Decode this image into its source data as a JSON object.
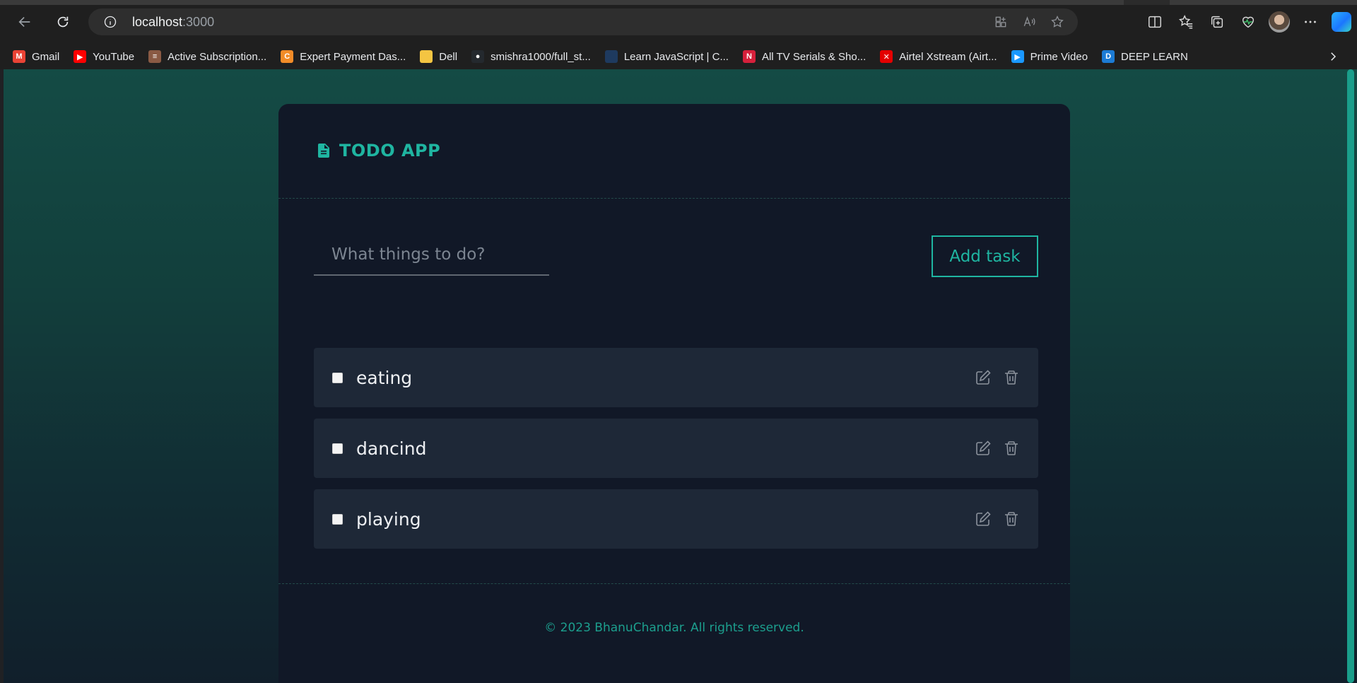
{
  "browser": {
    "url_host": "localhost",
    "url_port": ":3000",
    "bookmarks": [
      {
        "label": "Gmail",
        "color": "#ea4335",
        "glyph": "M"
      },
      {
        "label": "YouTube",
        "color": "#ff0000",
        "glyph": "▶"
      },
      {
        "label": "Active Subscription...",
        "color": "#8a5a44",
        "glyph": "≡"
      },
      {
        "label": "Expert Payment Das...",
        "color": "#f28c28",
        "glyph": "C"
      },
      {
        "label": "Dell",
        "color": "#f4c542",
        "glyph": ""
      },
      {
        "label": "smishra1000/full_st...",
        "color": "#24292e",
        "glyph": "●"
      },
      {
        "label": "Learn JavaScript | C...",
        "color": "#1e3a5f",
        "glyph": ""
      },
      {
        "label": "All TV Serials & Sho...",
        "color": "#d6203b",
        "glyph": "N"
      },
      {
        "label": "Airtel Xstream (Airt...",
        "color": "#e40000",
        "glyph": "✕"
      },
      {
        "label": "Prime Video",
        "color": "#1a98ff",
        "glyph": "▶"
      },
      {
        "label": "DEEP LEARN",
        "color": "#1c7bd4",
        "glyph": "D"
      }
    ]
  },
  "app": {
    "title": "TODO APP",
    "input_placeholder": "What things to do?",
    "add_button": "Add task",
    "tasks": [
      {
        "label": "eating"
      },
      {
        "label": "dancind"
      },
      {
        "label": "playing"
      }
    ],
    "footer": "© 2023 BhanuChandar. All rights reserved.",
    "accent_color": "#1fb5a1"
  }
}
